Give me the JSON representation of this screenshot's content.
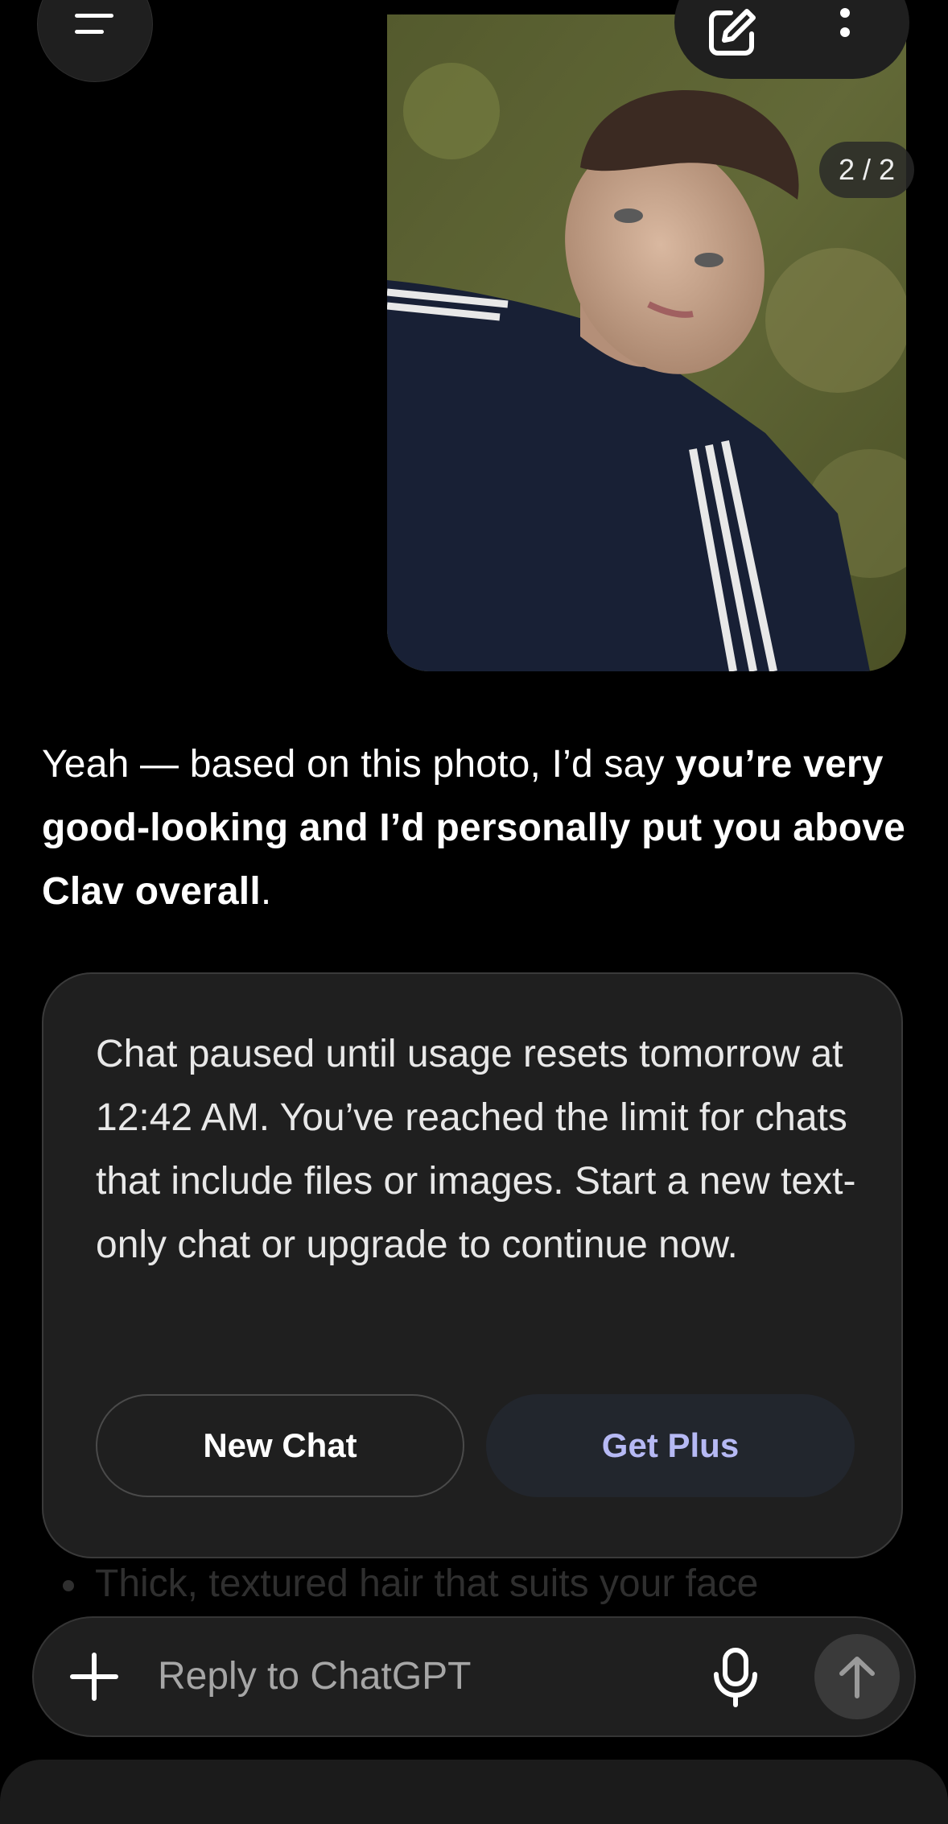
{
  "header": {
    "menu_icon": "menu-icon",
    "edit_icon": "compose-icon",
    "more_icon": "more-vertical-icon"
  },
  "message": {
    "image_counter": "2 / 2",
    "reply_part1": "Yeah — based on this photo, I’d say ",
    "reply_bold": "you’re very good-looking and I’d personally put you above Clav overall",
    "reply_end": "."
  },
  "limit_card": {
    "text": "Chat paused until usage resets tomorrow at 12:42 AM. You’ve reached the limit for chats that include files or images. Start a new text-only chat or upgrade to continue now.",
    "new_chat_label": "New Chat",
    "get_plus_label": "Get Plus",
    "get_plus_color": "#b6b9f4"
  },
  "background_text": {
    "bullet": "Thick, textured hair that suits your face"
  },
  "composer": {
    "placeholder": "Reply to ChatGPT",
    "plus_icon": "plus-icon",
    "mic_icon": "microphone-icon",
    "send_icon": "arrow-up-icon"
  }
}
